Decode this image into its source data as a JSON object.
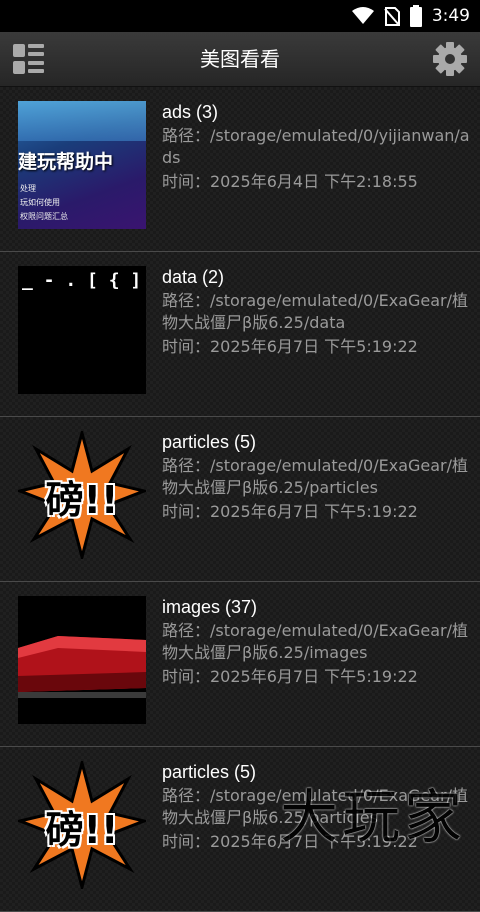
{
  "status_bar": {
    "time": "3:49"
  },
  "toolbar": {
    "title": "美图看看",
    "menu_icon": "menu-icon",
    "settings_icon": "gear-icon"
  },
  "folders": [
    {
      "name": "ads (3)",
      "path": "路径：/storage/emulated/0/yijianwan/ads",
      "time": "时间：2025年6月4日 下午2:18:55",
      "thumb_text": "建玩帮助中",
      "thumb_lines": [
        "处理",
        "玩如何使用",
        "权限问题汇总"
      ]
    },
    {
      "name": "data (2)",
      "path": "路径：/storage/emulated/0/ExaGear/植物大战僵尸β版6.25/data",
      "time": "时间：2025年6月7日 下午5:19:22",
      "thumb_text": "_ - . [ { ] ]"
    },
    {
      "name": "particles (5)",
      "path": "路径：/storage/emulated/0/ExaGear/植物大战僵尸β版6.25/particles",
      "time": "时间：2025年6月7日 下午5:19:22",
      "thumb_text": "磅!!"
    },
    {
      "name": "images (37)",
      "path": "路径：/storage/emulated/0/ExaGear/植物大战僵尸β版6.25/images",
      "time": "时间：2025年6月7日 下午5:19:22"
    },
    {
      "name": "particles (5)",
      "path": "路径：/storage/emulated/0/ExaGear/植物大战僵尸β版6.25/particles",
      "time": "时间：2025年6月7日 下午5:19:22",
      "thumb_text": "磅!!"
    }
  ],
  "watermark": "大玩家"
}
